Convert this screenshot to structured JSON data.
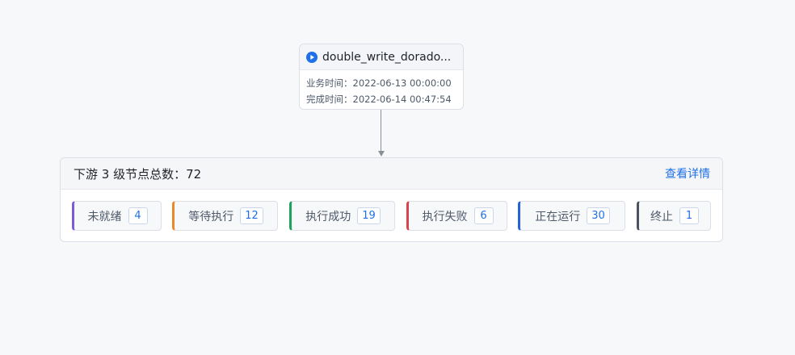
{
  "task_node": {
    "name": "double_write_dorado...",
    "business_time_label": "业务时间：",
    "business_time": "2022-06-13 00:00:00",
    "finish_time_label": "完成时间：",
    "finish_time": "2022-06-14 00:47:54",
    "icon": "play-icon"
  },
  "downstream": {
    "title": "下游 3 级节点总数：72",
    "details_link": "查看详情",
    "statuses": [
      {
        "label": "未就绪",
        "count": "4",
        "color": "#7b5cd6"
      },
      {
        "label": "等待执行",
        "count": "12",
        "color": "#e8892b"
      },
      {
        "label": "执行成功",
        "count": "19",
        "color": "#1aa35a"
      },
      {
        "label": "执行失败",
        "count": "6",
        "color": "#d9444a"
      },
      {
        "label": "正在运行",
        "count": "30",
        "color": "#2464d6"
      },
      {
        "label": "终止",
        "count": "1",
        "color": "#4a5360"
      }
    ]
  }
}
